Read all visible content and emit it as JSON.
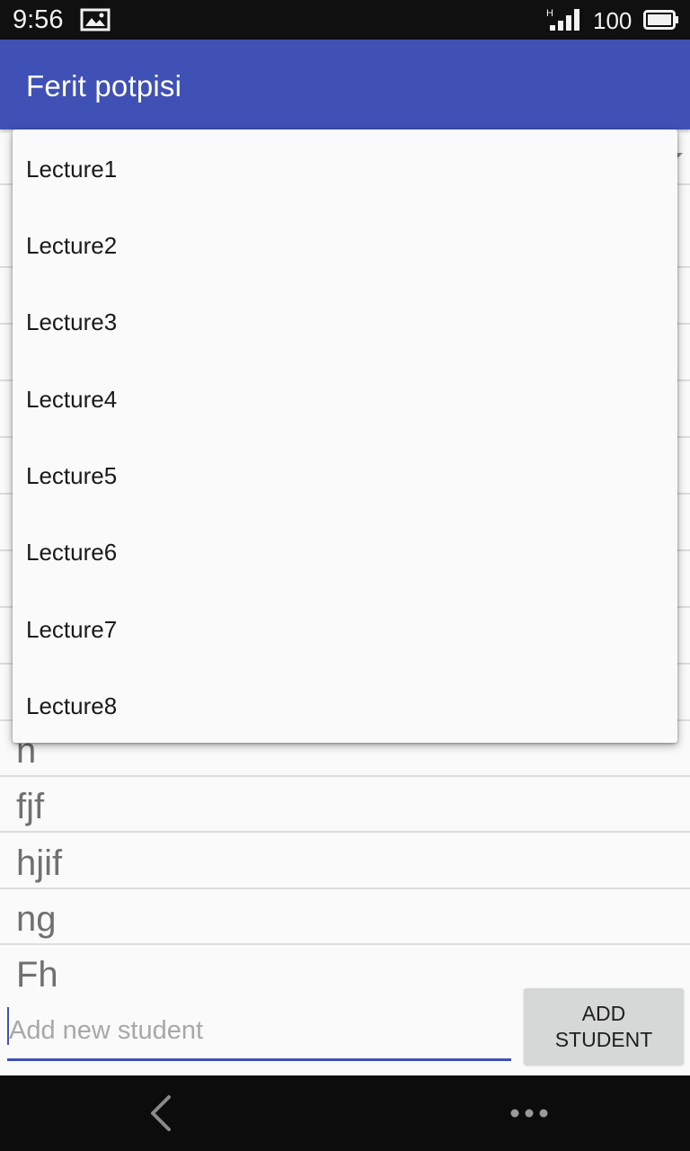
{
  "status_bar": {
    "time": "9:56",
    "battery_level": "100",
    "icons": [
      "image-notification-icon",
      "signal-icon",
      "battery-icon"
    ]
  },
  "app_bar": {
    "title": "Ferit potpisi",
    "background_color": "#3f51b5"
  },
  "dropdown": {
    "items": [
      {
        "label": "Lecture1"
      },
      {
        "label": "Lecture2"
      },
      {
        "label": "Lecture3"
      },
      {
        "label": "Lecture4"
      },
      {
        "label": "Lecture5"
      },
      {
        "label": "Lecture6"
      },
      {
        "label": "Lecture7"
      },
      {
        "label": "Lecture8"
      }
    ]
  },
  "student_list": {
    "items": [
      {
        "name": "n"
      },
      {
        "name": "fjf"
      },
      {
        "name": "hjif"
      },
      {
        "name": "ng"
      },
      {
        "name": "Fh"
      }
    ]
  },
  "new_student": {
    "placeholder": "Add new student",
    "value": ""
  },
  "add_button": {
    "label": "ADD\nSTUDENT"
  },
  "nav_bar": {
    "icons": [
      "back-icon",
      "more-icon"
    ]
  },
  "colors": {
    "accent": "#3f51b5",
    "status_bar": "#101010",
    "nav_bar": "#0c0c0c",
    "button": "#d6d7d7"
  }
}
